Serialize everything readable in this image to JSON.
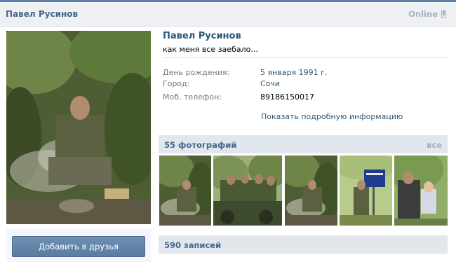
{
  "header": {
    "name": "Павел Русинов",
    "status_text": "Online"
  },
  "profile": {
    "name": "Павел Русинов",
    "status": "как меня все заебало...",
    "fields": [
      {
        "label": "День рождения:",
        "value": "5 января 1991 г."
      },
      {
        "label": "Город:",
        "value": "Сочи"
      },
      {
        "label": "Моб. телефон:",
        "value": "89186150017"
      }
    ],
    "more_link": "Показать подробную информацию"
  },
  "actions": {
    "add_friend": "Добавить в друзья"
  },
  "photos": {
    "title": "55 фотографий",
    "all_link": "все"
  },
  "posts": {
    "title": "590 записей"
  },
  "colors": {
    "link": "#2b587a",
    "header_text": "#45688e",
    "button": "#5a7ca2",
    "section_bg": "#e1e7ed"
  }
}
